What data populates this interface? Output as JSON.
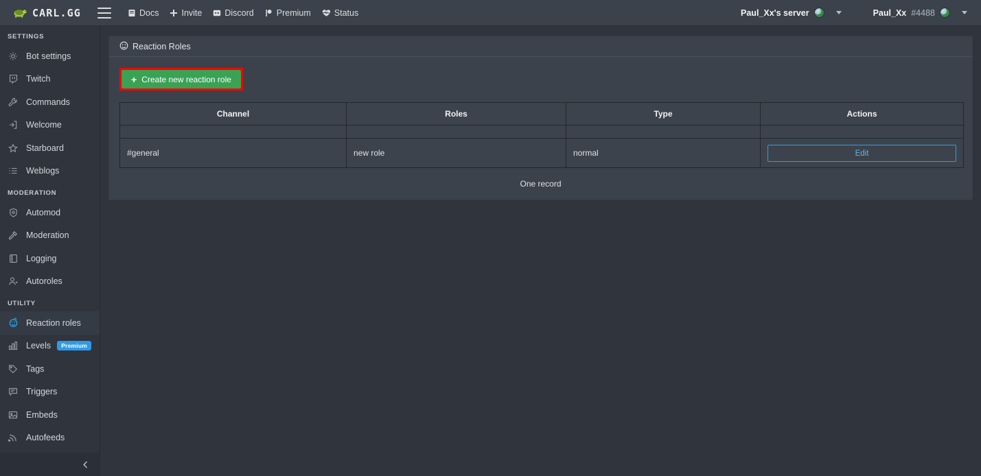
{
  "brand": {
    "name": "CARL.GG",
    "logo_icon": "turtle-icon"
  },
  "topnav": {
    "menu_icon": "hamburger-icon",
    "links": [
      {
        "label": "Docs",
        "icon": "book-icon"
      },
      {
        "label": "Invite",
        "icon": "plus-icon"
      },
      {
        "label": "Discord",
        "icon": "discord-icon"
      },
      {
        "label": "Premium",
        "icon": "flag-icon"
      },
      {
        "label": "Status",
        "icon": "heartbeat-icon"
      }
    ],
    "server": {
      "name": "Paul_Xx's server",
      "avatar_icon": "server-avatar",
      "caret_icon": "chevron-down-icon"
    },
    "user": {
      "name": "Paul_Xx",
      "discriminator": "#4488",
      "avatar_icon": "user-avatar",
      "caret_icon": "chevron-down-icon"
    }
  },
  "sidebar": {
    "sections": [
      {
        "title": "SETTINGS",
        "items": [
          {
            "label": "Bot settings",
            "icon": "gear-icon",
            "active": false,
            "badge": ""
          },
          {
            "label": "Twitch",
            "icon": "twitch-icon",
            "active": false,
            "badge": ""
          },
          {
            "label": "Commands",
            "icon": "wrench-icon",
            "active": false,
            "badge": ""
          },
          {
            "label": "Welcome",
            "icon": "sign-in-icon",
            "active": false,
            "badge": ""
          },
          {
            "label": "Starboard",
            "icon": "star-icon",
            "active": false,
            "badge": ""
          },
          {
            "label": "Weblogs",
            "icon": "list-icon",
            "active": false,
            "badge": ""
          }
        ]
      },
      {
        "title": "MODERATION",
        "items": [
          {
            "label": "Automod",
            "icon": "shield-icon",
            "active": false,
            "badge": ""
          },
          {
            "label": "Moderation",
            "icon": "hammer-icon",
            "active": false,
            "badge": ""
          },
          {
            "label": "Logging",
            "icon": "book-open-icon",
            "active": false,
            "badge": ""
          },
          {
            "label": "Autoroles",
            "icon": "user-plus-icon",
            "active": false,
            "badge": ""
          }
        ]
      },
      {
        "title": "UTILITY",
        "items": [
          {
            "label": "Reaction roles",
            "icon": "reaction-role-icon",
            "active": true,
            "badge": ""
          },
          {
            "label": "Levels",
            "icon": "bar-chart-icon",
            "active": false,
            "badge": "Premium"
          },
          {
            "label": "Tags",
            "icon": "tag-icon",
            "active": false,
            "badge": ""
          },
          {
            "label": "Triggers",
            "icon": "comment-icon",
            "active": false,
            "badge": ""
          },
          {
            "label": "Embeds",
            "icon": "image-icon",
            "active": false,
            "badge": ""
          },
          {
            "label": "Autofeeds",
            "icon": "rss-icon",
            "active": false,
            "badge": ""
          }
        ]
      }
    ],
    "collapse_icon": "chevron-left-icon"
  },
  "panel": {
    "title": "Reaction Roles",
    "title_icon": "smiley-icon",
    "create_button": {
      "label": "Create new reaction role",
      "icon": "plus-icon",
      "highlighted": true
    },
    "table": {
      "columns": [
        "Channel",
        "Roles",
        "Type",
        "Actions"
      ],
      "rows": [
        {
          "channel": "#general",
          "roles": "new role",
          "type": "normal",
          "action_label": "Edit"
        }
      ],
      "record_count_text": "One record"
    }
  },
  "colors": {
    "page_background": "#30343d",
    "panel_background": "#3b424b",
    "sidebar_background": "#2f343d",
    "accent_green": "#3aa255",
    "accent_blue": "#2e9fe0",
    "highlight_red": "#ff0000",
    "premium_badge": "#2f9ae8"
  }
}
